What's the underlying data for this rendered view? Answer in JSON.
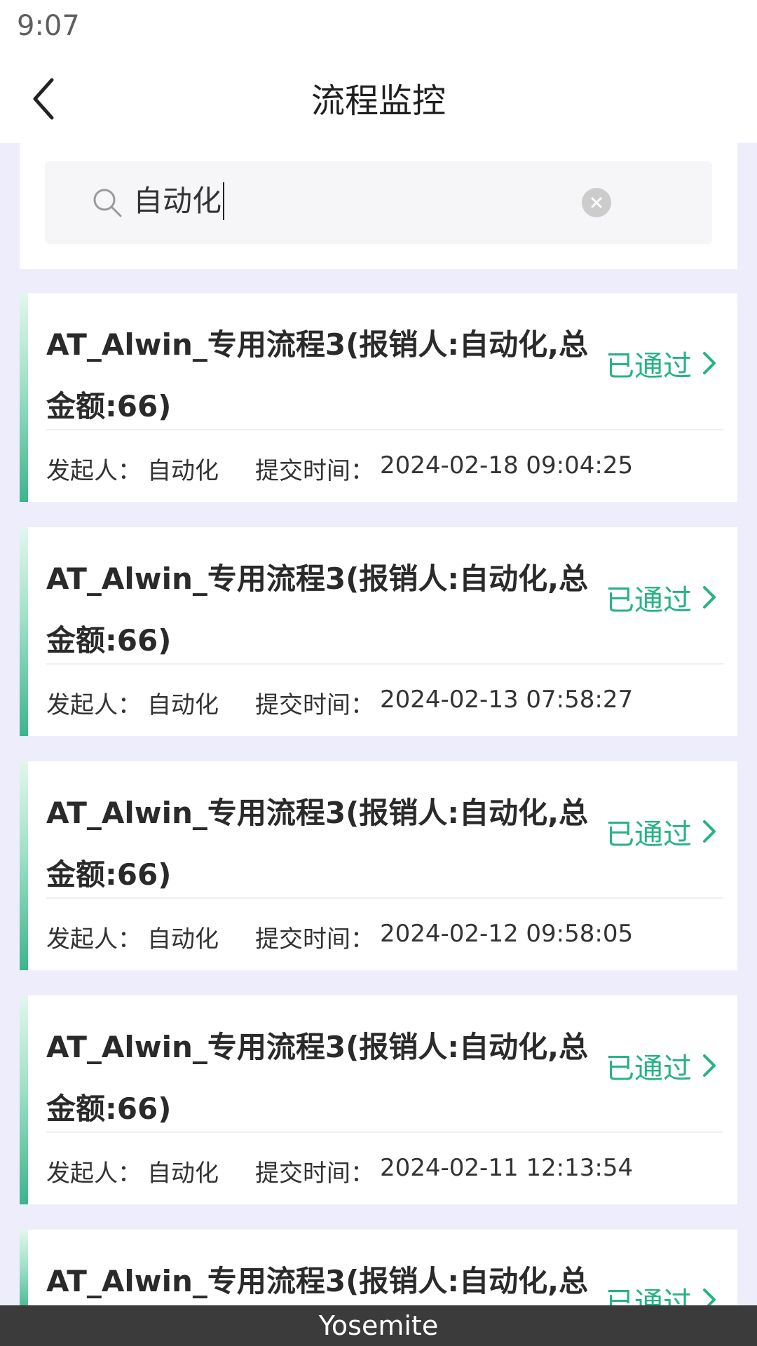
{
  "status_bar": {
    "time": "9:07"
  },
  "header": {
    "title": "流程监控",
    "back_icon": "chevron-left-icon"
  },
  "search": {
    "value": "自动化",
    "icon": "search-icon",
    "clear_icon": "clear-circle-icon"
  },
  "colors": {
    "status_green": "#27b383",
    "accent_bar": "#3db58c",
    "page_bg": "#eeedfb"
  },
  "records": [
    {
      "title": "AT_Alwin_专用流程3(报销人:自动化,总金额:66)",
      "status": "已通过",
      "initiator_label": "发起人：",
      "initiator": "自动化",
      "time_label": "提交时间：",
      "submit_time": "2024-02-18 09:04:25"
    },
    {
      "title": "AT_Alwin_专用流程3(报销人:自动化,总金额:66)",
      "status": "已通过",
      "initiator_label": "发起人：",
      "initiator": "自动化",
      "time_label": "提交时间：",
      "submit_time": "2024-02-13 07:58:27"
    },
    {
      "title": "AT_Alwin_专用流程3(报销人:自动化,总金额:66)",
      "status": "已通过",
      "initiator_label": "发起人：",
      "initiator": "自动化",
      "time_label": "提交时间：",
      "submit_time": "2024-02-12 09:58:05"
    },
    {
      "title": "AT_Alwin_专用流程3(报销人:自动化,总金额:66)",
      "status": "已通过",
      "initiator_label": "发起人：",
      "initiator": "自动化",
      "time_label": "提交时间：",
      "submit_time": "2024-02-11 12:13:54"
    },
    {
      "title": "AT_Alwin_专用流程3(报销人:自动化,总",
      "status": "已通过"
    }
  ],
  "bottom_bar": {
    "label": "Yosemite"
  }
}
